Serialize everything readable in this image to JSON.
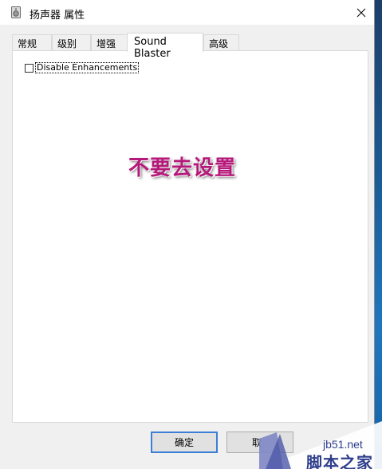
{
  "window": {
    "title": "扬声器 属性",
    "close_glyph": "✕"
  },
  "tabs": [
    {
      "label": "常规",
      "active": false
    },
    {
      "label": "级别",
      "active": false
    },
    {
      "label": "增强",
      "active": false
    },
    {
      "label": "Sound Blaster",
      "active": true
    },
    {
      "label": "高级",
      "active": false
    }
  ],
  "panel": {
    "disable_enhancements": {
      "label": "Disable Enhancements",
      "checked": false
    },
    "overlay_annotation": "不要去设置"
  },
  "buttons": {
    "ok_label": "确定",
    "cancel_label": "取"
  },
  "watermark": {
    "url": "jb51.net",
    "brand": "脚本之家"
  },
  "colors": {
    "annotation": "#b5197a",
    "ok_focus_border": "#3c7fd6",
    "watermark_text": "#2f3e8c"
  }
}
